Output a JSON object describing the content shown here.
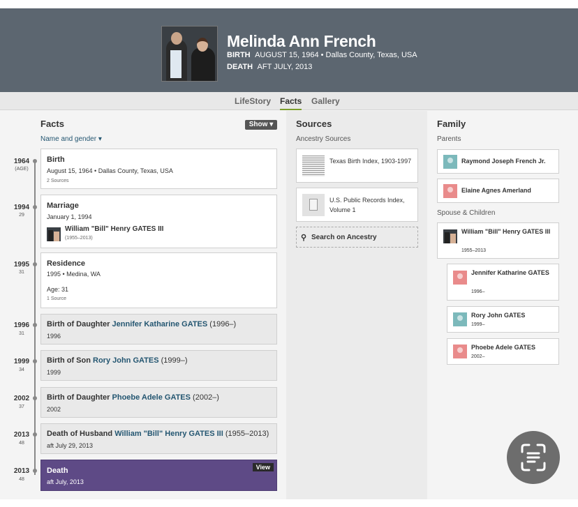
{
  "person": {
    "name": "Melinda Ann French",
    "birth_label": "BIRTH",
    "birth_value": "AUGUST 15, 1964 • Dallas County, Texas, USA",
    "death_label": "DEATH",
    "death_value": "AFT JULY, 2013"
  },
  "tabs": [
    "LifeStory",
    "Facts",
    "Gallery"
  ],
  "facts": {
    "title": "Facts",
    "show_label": "Show",
    "filter_label": "Name and gender",
    "events": [
      {
        "year": "1964",
        "age": "(AGE)",
        "title": "Birth",
        "detail": "August 15, 1964 • Dallas County, Texas, USA",
        "sources": "2 Sources"
      },
      {
        "year": "1994",
        "age": "29",
        "title": "Marriage",
        "detail": "January 1, 1994",
        "spouse": "William \"Bill\" Henry GATES III",
        "spouse_years": "(1955–2013)"
      },
      {
        "year": "1995",
        "age": "31",
        "title": "Residence",
        "detail": "1995 • Medina, WA",
        "extra": "Age: 31",
        "sources": "1 Source"
      },
      {
        "year": "1996",
        "age": "31",
        "title_prefix": "Birth of Daughter",
        "link": "Jennifer Katharine GATES",
        "suffix": "(1996–)",
        "detail": "1996"
      },
      {
        "year": "1999",
        "age": "34",
        "title_prefix": "Birth of Son",
        "link": "Rory John GATES",
        "suffix": "(1999–)",
        "detail": "1999"
      },
      {
        "year": "2002",
        "age": "37",
        "title_prefix": "Birth of Daughter",
        "link": "Phoebe Adele GATES",
        "suffix": "(2002–)",
        "detail": "2002"
      },
      {
        "year": "2013",
        "age": "48",
        "title_prefix": "Death of Husband",
        "link": "William \"Bill\" Henry GATES III",
        "suffix": "(1955–2013)",
        "detail": "aft July 29, 2013"
      },
      {
        "year": "2013",
        "age": "48",
        "title": "Death",
        "detail": "aft July, 2013",
        "view_label": "View"
      }
    ]
  },
  "sources": {
    "title": "Sources",
    "subtitle": "Ancestry Sources",
    "items": [
      {
        "label": "Texas Birth Index, 1903-1997"
      },
      {
        "label": "U.S. Public Records Index, Volume 1"
      }
    ],
    "search_label": "Search on Ancestry"
  },
  "family": {
    "title": "Family",
    "parents_label": "Parents",
    "parents": [
      {
        "name": "Raymond Joseph French Jr.",
        "gender": "m"
      },
      {
        "name": "Elaine Agnes Amerland",
        "gender": "f"
      }
    ],
    "spouse_label": "Spouse & Children",
    "spouse": {
      "name": "William \"Bill\" Henry GATES III",
      "years": "1955–2013"
    },
    "children": [
      {
        "name": "Jennifer Katharine GATES",
        "years": "1996–",
        "gender": "f"
      },
      {
        "name": "Rory John GATES",
        "years": "1999–",
        "gender": "m"
      },
      {
        "name": "Phoebe Adele GATES",
        "years": "2002–",
        "gender": "f"
      }
    ]
  },
  "colors": {
    "header": "#5c6670",
    "accent_tab": "#7b9e2c",
    "death_card": "#5e4a86",
    "link": "#245671"
  }
}
